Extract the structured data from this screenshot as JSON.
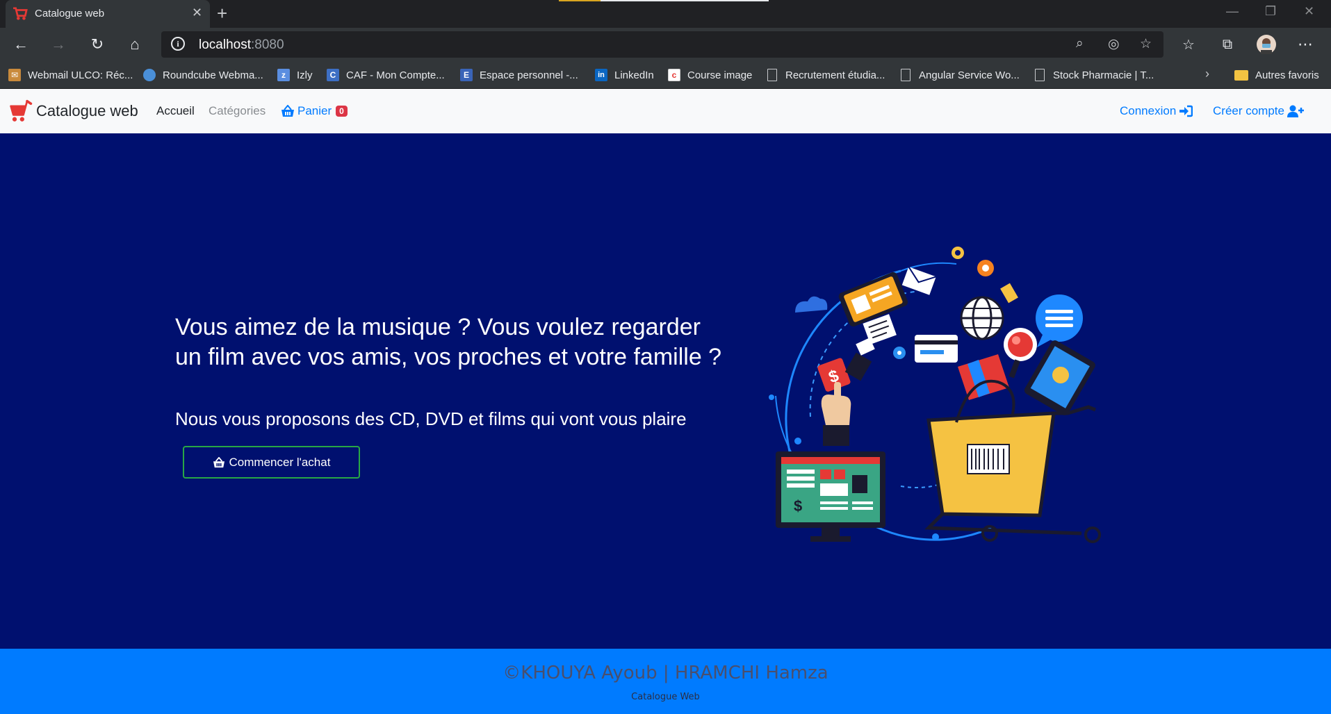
{
  "browser": {
    "tab_title": "Catalogue web",
    "tab_close": "✕",
    "new_tab": "+",
    "url_host": "localhost",
    "url_port": ":8080",
    "bookmarks": [
      {
        "label": "Webmail ULCO: Réc...",
        "icon": "webmail-icon"
      },
      {
        "label": "Roundcube Webma...",
        "icon": "roundcube-icon"
      },
      {
        "label": "Izly",
        "icon": "izly-icon"
      },
      {
        "label": "CAF - Mon Compte...",
        "icon": "caf-icon"
      },
      {
        "label": "Espace personnel -...",
        "icon": "espace-icon"
      },
      {
        "label": "LinkedIn",
        "icon": "linkedin-icon"
      },
      {
        "label": "Course image",
        "icon": "course-icon"
      },
      {
        "label": "Recrutement étudia...",
        "icon": "document-icon"
      },
      {
        "label": "Angular Service Wo...",
        "icon": "document-icon"
      },
      {
        "label": "Stock Pharmacie | T...",
        "icon": "document-icon"
      }
    ],
    "other_favorites": "Autres favoris"
  },
  "navbar": {
    "brand": "Catalogue web",
    "home": "Accueil",
    "categories": "Catégories",
    "cart": "Panier",
    "cart_count": "0",
    "login": "Connexion",
    "register": "Créer compte"
  },
  "hero": {
    "title": "Vous aimez de la musique ? Vous voulez regarder un film avec vos amis, vos proches et votre famille ?",
    "subtitle": "Nous vous proposons des CD, DVD et films qui vont vous plaire",
    "cta": "Commencer l'achat"
  },
  "footer": {
    "copyright": "©KHOUYA Ayoub | HRAMCHI Hamza",
    "subtitle": "Catalogue Web"
  },
  "colors": {
    "hero_bg": "#00106f",
    "footer_bg": "#007bff",
    "link": "#007bff",
    "badge": "#dc3545",
    "cta_border": "#28a745"
  }
}
